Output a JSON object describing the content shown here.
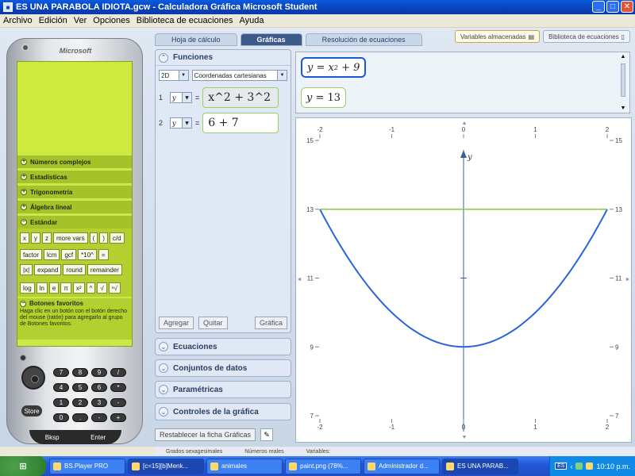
{
  "window": {
    "title": "ES UNA PARABOLA IDIOTA.gcw - Calculadora Gráfica Microsoft Student",
    "buttons": [
      "_",
      "□",
      "✕"
    ]
  },
  "menu": [
    "Archivo",
    "Edición",
    "Ver",
    "Opciones",
    "Biblioteca de ecuaciones",
    "Ayuda"
  ],
  "calculator": {
    "brand": "Microsoft",
    "categories": [
      "Números complejos",
      "Estadísticas",
      "Trigonometría",
      "Álgebra lineal",
      "Estándar"
    ],
    "keys": {
      "row1": [
        "x",
        "y",
        "z",
        "more vars",
        "(",
        ")",
        "c/d"
      ],
      "row2": [
        "factor",
        "lcm",
        "gcf",
        "*10^",
        "="
      ],
      "row3": [
        "|x|",
        "expand",
        "round",
        "remainder"
      ],
      "row4": [
        "log",
        "ln",
        "e",
        "π",
        "x²",
        "^",
        "√",
        "ⁿ√"
      ]
    },
    "favorites_title": "Botones favoritos",
    "favorites_text": "Haga clic en un botón con el botón derecho del mouse (ratón) para agregarlo al grupo de Botones favoritos.",
    "numpad": [
      "7",
      "8",
      "9",
      "/",
      "4",
      "5",
      "6",
      "*",
      "1",
      "2",
      "3",
      "-",
      "0",
      ".",
      "-",
      "+"
    ],
    "store": "Store",
    "bksp": "Bksp",
    "enter": "Enter"
  },
  "tabs": [
    "Hoja de cálculo",
    "Gráficas",
    "Resolución de ecuaciones"
  ],
  "active_tab": 1,
  "toplinks": [
    "Variables almacenadas",
    "Biblioteca de ecuaciones"
  ],
  "functions_panel": {
    "title": "Funciones",
    "dimension": "2D",
    "coordinates": "Coordenadas cartesianas",
    "rows": [
      {
        "num": "1",
        "var": "y",
        "eq": "=",
        "expr": "x^2 + 3^2"
      },
      {
        "num": "2",
        "var": "y",
        "eq": "=",
        "expr": "6 + 7"
      }
    ],
    "add_btn": "Agregar",
    "remove_btn": "Quitar",
    "graph_btn": "Gráfica"
  },
  "sections": [
    "Ecuaciones",
    "Conjuntos de datos",
    "Paramétricas",
    "Controles de la gráfica"
  ],
  "reset_btn": "Restablecer la ficha Gráficas",
  "equations": [
    {
      "lhs": "y =",
      "base": "x",
      "exp": "2",
      "rest": "+ 9"
    },
    {
      "lhs": "y =",
      "text": "13"
    }
  ],
  "chart_data": {
    "type": "line",
    "xlim": [
      -2,
      2
    ],
    "ylim": [
      7,
      15
    ],
    "xticks": [
      -2,
      -1,
      0,
      1,
      2
    ],
    "yticks": [
      7,
      9,
      11,
      13,
      15
    ],
    "ylabel": "y",
    "series": [
      {
        "color": "#2a64d8",
        "x": [
          -2,
          -1.5,
          -1,
          -0.5,
          0,
          0.5,
          1,
          1.5,
          2
        ],
        "y": [
          13,
          11.25,
          10,
          9.25,
          9,
          9.25,
          10,
          11.25,
          13
        ]
      },
      {
        "color": "#8dc63f",
        "x": [
          -2,
          2
        ],
        "y": [
          13,
          13
        ]
      }
    ]
  },
  "status": [
    "Grados sexagesimales",
    "Números reales",
    "Variables:"
  ],
  "taskbar": {
    "start": "Inicio",
    "tasks": [
      "BS.Player PRO",
      "[c=15][b]Menk...",
      "animales",
      "paint.png (78%...",
      "Administrador d...",
      "ES UNA PARAB..."
    ],
    "lang": "ES",
    "clock": "10:10 p.m."
  }
}
